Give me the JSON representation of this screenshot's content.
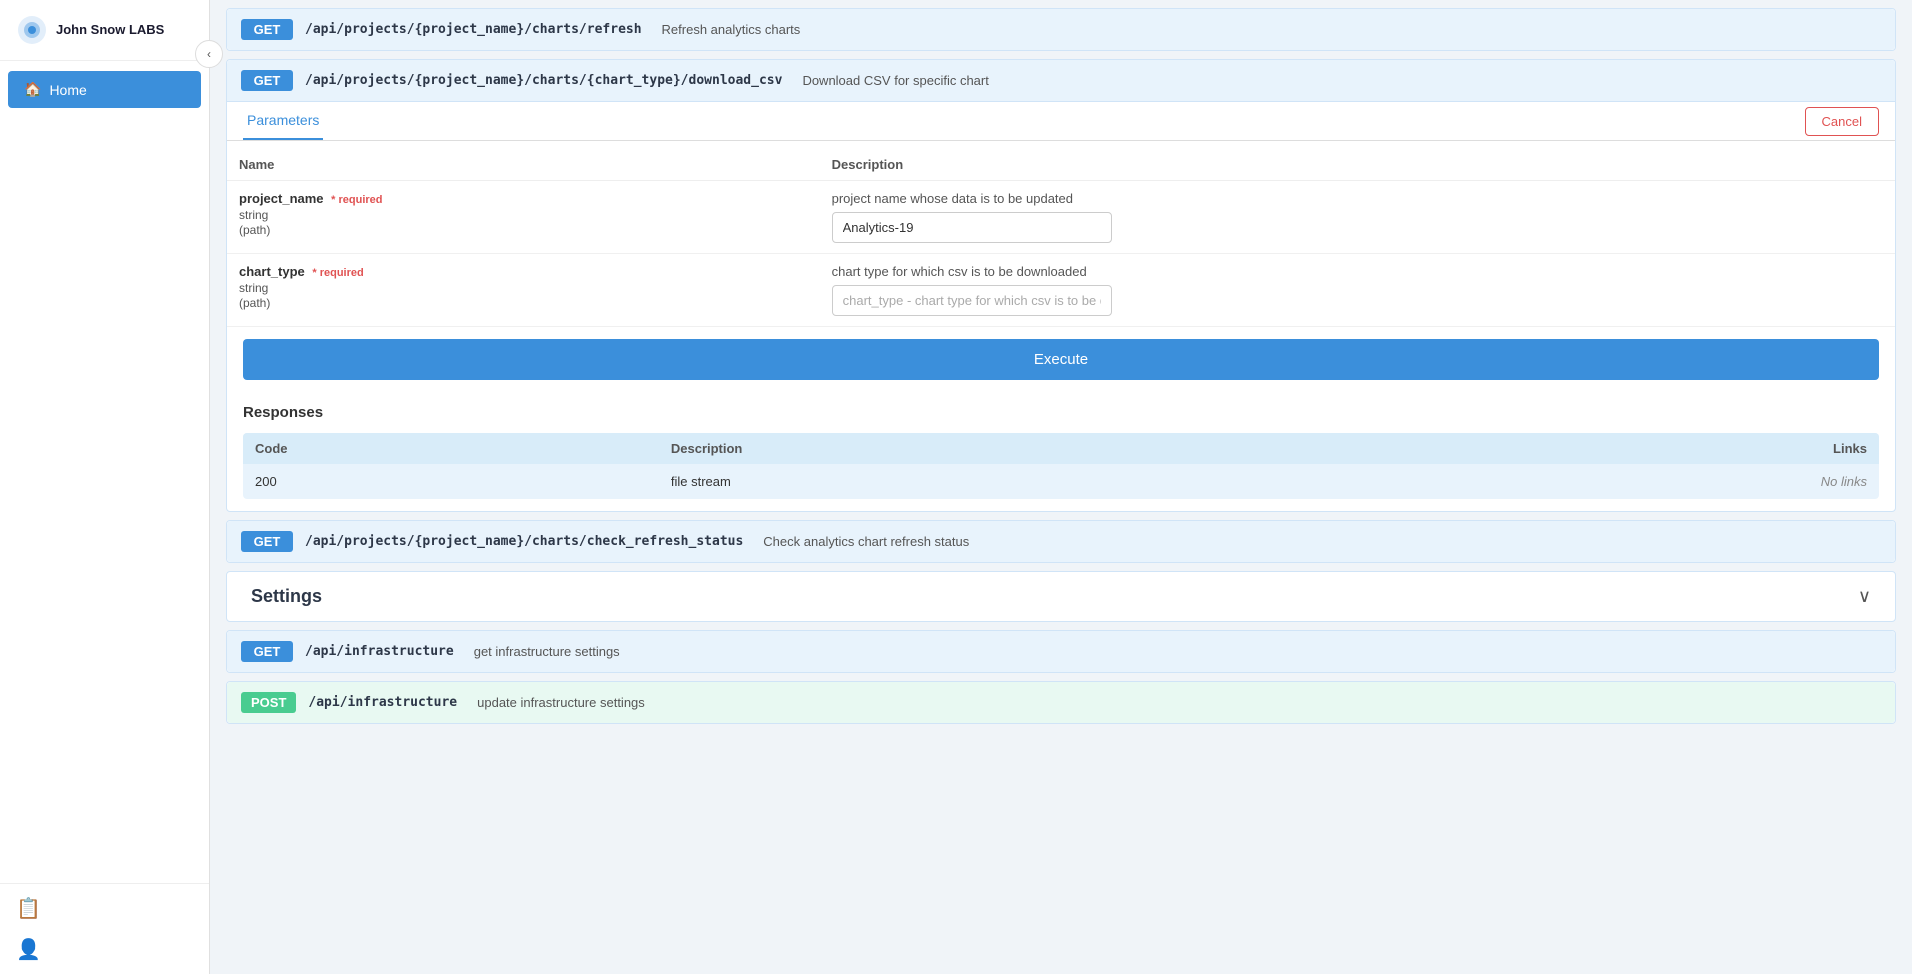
{
  "sidebar": {
    "logo_text": "John Snow LABS",
    "nav_items": [
      {
        "label": "Home",
        "icon": "home-icon",
        "active": true
      }
    ],
    "bottom_icons": [
      {
        "icon": "document-icon",
        "name": "docs-icon"
      },
      {
        "icon": "user-icon",
        "name": "user-icon"
      }
    ],
    "collapse_icon": "‹"
  },
  "api_endpoints": [
    {
      "id": "refresh-charts",
      "method": "GET",
      "path": "/api/projects/{project_name}/charts/refresh",
      "description": "Refresh analytics charts",
      "collapsed": true
    },
    {
      "id": "download-csv",
      "method": "GET",
      "path": "/api/projects/{project_name}/charts/{chart_type}/download_csv",
      "description": "Download CSV for specific chart",
      "collapsed": false,
      "tabs": [
        {
          "label": "Parameters",
          "active": true
        }
      ],
      "cancel_label": "Cancel",
      "parameters": [
        {
          "name": "project_name",
          "required": true,
          "required_label": "required",
          "type": "string",
          "location": "(path)",
          "description": "project name whose data is to be updated",
          "value": "Analytics-19",
          "placeholder": ""
        },
        {
          "name": "chart_type",
          "required": true,
          "required_label": "required",
          "type": "string",
          "location": "(path)",
          "description": "chart type for which csv is to be downloaded",
          "value": "",
          "placeholder": "chart_type - chart type for which csv is to be d..."
        }
      ],
      "execute_label": "Execute",
      "responses_title": "Responses",
      "responses_headers": {
        "code": "Code",
        "description": "Description",
        "links": "Links"
      },
      "responses_rows": [
        {
          "code": "200",
          "description": "file stream",
          "links": "No links"
        }
      ]
    },
    {
      "id": "check-refresh-status",
      "method": "GET",
      "path": "/api/projects/{project_name}/charts/check_refresh_status",
      "description": "Check analytics chart refresh status",
      "collapsed": true
    }
  ],
  "settings_section": {
    "title": "Settings",
    "chevron": "˅",
    "items": [
      {
        "method": "GET",
        "path": "/api/infrastructure",
        "description": "get infrastructure settings"
      },
      {
        "method": "POST",
        "path": "/api/infrastructure",
        "description": "update infrastructure settings"
      }
    ]
  }
}
